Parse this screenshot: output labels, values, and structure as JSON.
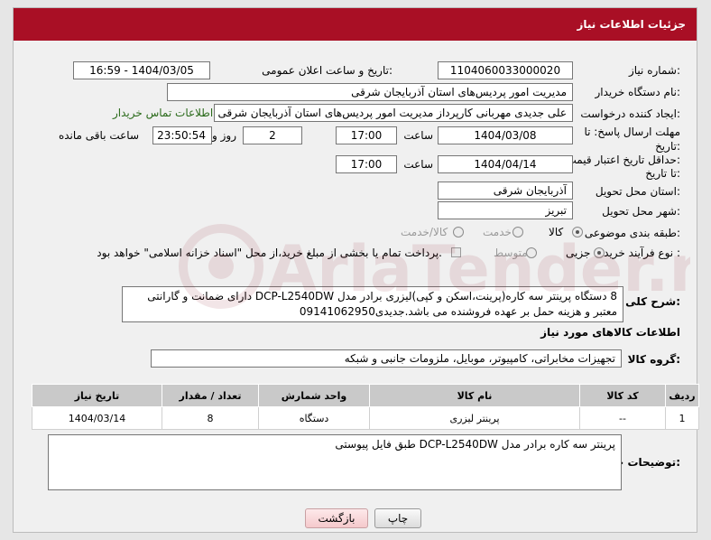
{
  "title": "جزئیات اطلاعات نیاز",
  "fields": {
    "need_number_label": "شماره نیاز:",
    "need_number": "1104060033000020",
    "announce_label": "تاریخ و ساعت اعلان عمومی:",
    "announce_value": "1404/03/05 - 16:59",
    "buyer_org_label": "نام دستگاه خریدار:",
    "buyer_org": "مدیریت امور پردیس‌های استان آذربایجان شرقی",
    "creator_label": "ایجاد کننده درخواست:",
    "creator": "علی جدیدی مهربانی کارپرداز مدیریت امور پردیس‌های استان آذربایجان شرقی",
    "contact_link": "اطلاعات تماس خریدار",
    "reply_deadline_label_1": "مهلت ارسال پاسخ: تا",
    "reply_deadline_label_2": "تاریخ:",
    "reply_date": "1404/03/08",
    "time_label": "ساعت",
    "reply_time": "17:00",
    "day_count": "2",
    "day_and_label": "روز و",
    "remaining_time": "23:50:54",
    "remaining_label": "ساعت باقی مانده",
    "validity_label_1": "حداقل تاریخ اعتبار قیمت:",
    "validity_label_2": "تا تاریخ:",
    "validity_date": "1404/04/14",
    "validity_time_label": "ساعت",
    "validity_time": "17:00",
    "province_label": "استان محل تحویل:",
    "province": "آذربایجان شرقی",
    "city_label": "شهر محل تحویل:",
    "city": "تبریز",
    "category_label": "طبقه بندی موضوعی:",
    "category_options": [
      "کالا",
      "خدمت",
      "کالا/خدمت"
    ],
    "category_selected": "کالا",
    "process_label": "نوع فرآیند خرید :",
    "process_options": [
      "جزیی",
      "متوسط"
    ],
    "process_selected": "جزیی",
    "payment_note": "پرداخت تمام یا بخشی از مبلغ خرید،از محل \"اسناد خزانه اسلامی\" خواهد بود."
  },
  "general_desc_label": "شرح کلی نیاز:",
  "general_desc": "8 دستگاه پرینتر سه کاره(پرینت،اسکن و کپی)لیزری برادر مدل DCP-L2540DW دارای ضمانت و گارانتی معتبر و هزینه حمل بر عهده فروشنده می باشد.جدیدی09141062950",
  "goods_info_title": "اطلاعات کالاهای مورد نیاز",
  "goods_group_label": "گروه کالا:",
  "goods_group": "تجهیزات مخابراتی، کامپیوتر، موبایل، ملزومات جانبی و شبکه",
  "table": {
    "headers": [
      "ردیف",
      "کد کالا",
      "نام کالا",
      "واحد شمارش",
      "تعداد / مقدار",
      "تاریخ نیاز"
    ],
    "rows": [
      [
        "1",
        "--",
        "پرینتر لیزری",
        "دستگاه",
        "8",
        "1404/03/14"
      ]
    ]
  },
  "buyer_notes_label": "توضیحات خریدار:",
  "buyer_notes": "پرینتر سه کاره برادر مدل DCP-L2540DW طبق فایل پیوستی",
  "buttons": {
    "print": "چاپ",
    "back": "بازگشت"
  },
  "watermark": "AriaTender.neT"
}
